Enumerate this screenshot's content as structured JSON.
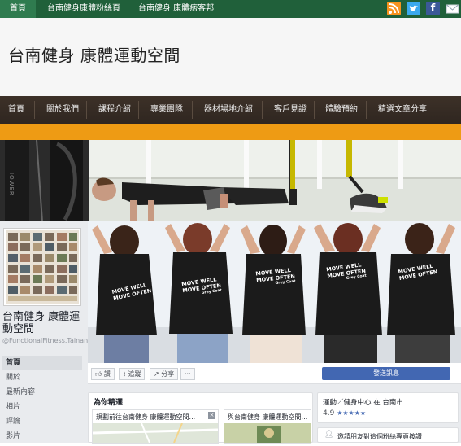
{
  "topbar": {
    "tabs": [
      "首頁",
      "台南健身康體粉絲頁",
      "台南健身 康體痞客邦"
    ]
  },
  "header": {
    "site_title": "台南健身 康體運動空間"
  },
  "nav": {
    "items": [
      "首頁",
      "關於我們",
      "課程介紹",
      "專業團隊",
      "器材場地介紹",
      "客戶見證",
      "體驗預約",
      "精選文章分享"
    ]
  },
  "colors": {
    "topbar": "#20603a",
    "nav": "#3a2f28",
    "orange_band": "#ee9b14",
    "fb_blue": "#4267b2",
    "rss": "#f7931e",
    "twitter": "#3ba9ee",
    "facebook": "#3b5998"
  },
  "hero": {
    "equipment_text": "IOWER"
  },
  "facebook": {
    "page_name": "台南健身 康體運動空間",
    "handle": "@FunctionalFitness.Tainan",
    "left_nav": [
      "首頁",
      "關於",
      "最新內容",
      "相片",
      "評論",
      "影片"
    ],
    "shirt_text": {
      "line1": "MOVE WELL",
      "line2": "MOVE OFTEN",
      "brand": "Grey Coat"
    },
    "actions": {
      "like": "讚",
      "follow": "追蹤",
      "share": "分享",
      "more": "···",
      "send": "發送訊息"
    },
    "for_you": {
      "title": "為你精選",
      "card1": "規劃前往台南健身 康體運動空間...",
      "card2": "與台南健身 康體運動空間..."
    },
    "info": {
      "category": "運動／健身中心 在 台南市",
      "rating": "4.9",
      "stars": "★★★★★"
    },
    "invite": "邀請朋友對這個粉絲專頁按讚"
  }
}
